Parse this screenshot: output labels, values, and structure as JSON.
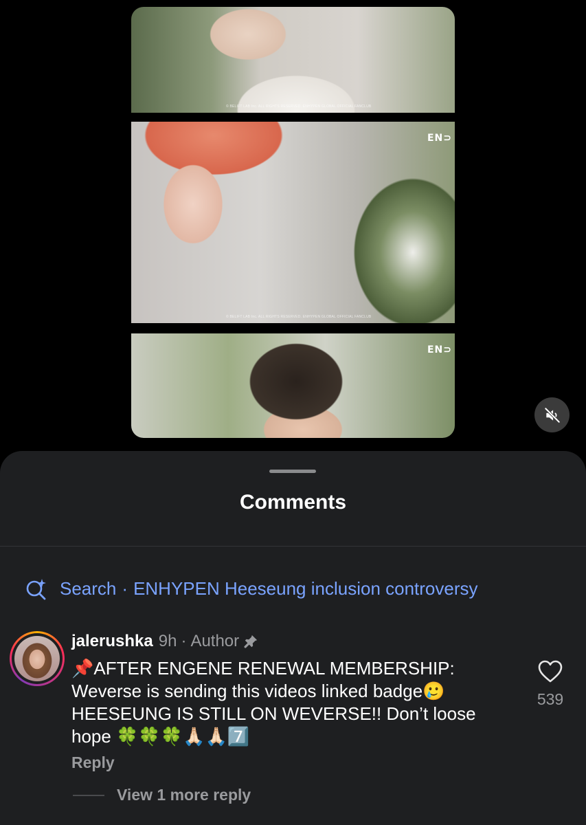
{
  "video": {
    "watermark_top": "© BELIFT LAB Inc. ALL RIGHTS RESERVED. ENHYPEN GLOBAL OFFICIAL FANCLUB",
    "watermark_middle": "© BELIFT LAB Inc. ALL RIGHTS RESERVED. ENHYPEN GLOBAL OFFICIAL FANCLUB",
    "logo_text": "EN⊃",
    "mute_icon": "speaker-muted-icon"
  },
  "sheet": {
    "title": "Comments",
    "search": {
      "icon": "search-sparkle-icon",
      "label": "Search",
      "separator": "·",
      "query": "ENHYPEN Heeseung inclusion controversy",
      "color": "#7aa3ff"
    }
  },
  "comment": {
    "username": "jalerushka",
    "time": "9h",
    "dot": "·",
    "badge": "Author",
    "pin_icon": "pin-icon",
    "text": "📌AFTER ENGENE RENEWAL MEMBERSHIP:\nWeverse is sending this videos linked badge🥲\nHEESEUNG IS STILL ON WEVERSE!! Don’t loose\nhope 🍀🍀🍀🙏🏻🙏🏻7️⃣",
    "like_icon": "heart-outline-icon",
    "like_count": "539",
    "reply_label": "Reply",
    "view_more": "View 1 more reply"
  }
}
